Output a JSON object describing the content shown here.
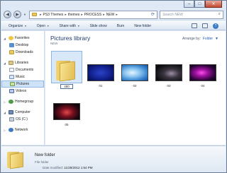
{
  "window": {
    "caption_minimize": "–",
    "caption_maximize": "□",
    "caption_close": "✕"
  },
  "address": {
    "back_icon": "back-arrow-icon",
    "forward_icon": "forward-arrow-icon",
    "crumbs": [
      "PS3 Themes",
      "themes",
      "PROCESS",
      "NEW"
    ],
    "separator": "▸",
    "search_placeholder": "Search NEW"
  },
  "toolbar": {
    "organize": "Organize",
    "open": "Open",
    "share_with": "Share with",
    "slide_show": "Slide show",
    "burn": "Burn",
    "new_folder": "New folder"
  },
  "nav": {
    "favorites": "Favorites",
    "desktop": "Desktop",
    "downloads": "Downloads",
    "libraries": "Libraries",
    "documents": "Documents",
    "music": "Music",
    "pictures": "Pictures",
    "videos": "Videos",
    "homegroup": "Homegroup",
    "computer": "Computer",
    "os_drive": "OS (C:)",
    "network": "Network"
  },
  "content": {
    "title": "Pictures library",
    "subtitle": "NEW",
    "arrange_label": "Arrange by:",
    "arrange_value": "Folder"
  },
  "items": [
    {
      "label": "480",
      "kind": "folder"
    },
    {
      "label": "01",
      "kind": "image"
    },
    {
      "label": "02",
      "kind": "image"
    },
    {
      "label": "03",
      "kind": "image"
    },
    {
      "label": "04",
      "kind": "image"
    },
    {
      "label": "05",
      "kind": "image"
    }
  ],
  "details": {
    "name": "New folder",
    "type": "File folder",
    "modified_label": "Date modified:",
    "modified_value": "11/28/2012 1:54 PM"
  }
}
